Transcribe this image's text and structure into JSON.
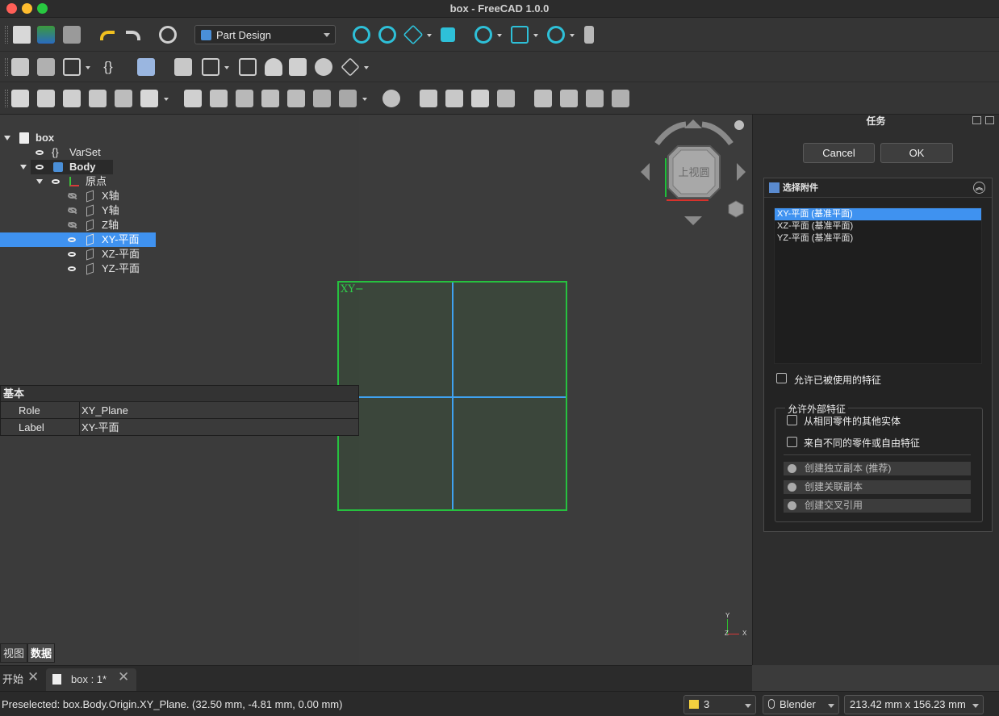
{
  "window": {
    "title": "box - FreeCAD 1.0.0"
  },
  "toolbar": {
    "workbench": "Part Design",
    "colors": {
      "accent": "#3f92f0",
      "plane_border": "#26c13f"
    }
  },
  "tree": {
    "root": "box",
    "varset": "VarSet",
    "varset_icon_glyph": "{}",
    "body": "Body",
    "origin": "原点",
    "x_axis": "X轴",
    "y_axis": "Y轴",
    "z_axis": "Z轴",
    "xy_plane": "XY-平面",
    "xz_plane": "XZ-平面",
    "yz_plane": "YZ-平面"
  },
  "properties": {
    "group": "基本",
    "rows": [
      {
        "name": "Role",
        "value": "XY_Plane"
      },
      {
        "name": "Label",
        "value": "XY-平面"
      }
    ]
  },
  "combo_tabs": {
    "view": "视图",
    "data": "数据"
  },
  "doc_tabs": {
    "start": "开始",
    "doc": "box : 1*"
  },
  "viewport": {
    "plane_label": "XY−",
    "navicube_face": "上视圆",
    "axis_y": "Y",
    "axis_z": "Z",
    "axis_x": "X"
  },
  "task": {
    "title": "任务",
    "cancel": "Cancel",
    "ok": "OK",
    "panel_title": "选择附件",
    "references": [
      "XY-平面 (基准平面)",
      "XZ-平面 (基准平面)",
      "YZ-平面 (基准平面)"
    ],
    "allow_used": "允许已被使用的特征",
    "external_legend": "允许外部特征",
    "same_part": "从相同零件的其他实体",
    "diff_part": "来自不同的零件或自由特征",
    "radio_independent": "创建独立副本 (推荐)",
    "radio_dependent": "创建关联副本",
    "radio_cross": "创建交叉引用"
  },
  "status": {
    "message": "Preselected: box.Body.Origin.XY_Plane. (32.50 mm, -4.81 mm, 0.00 mm)",
    "level": "3",
    "nav_style": "Blender",
    "dimensions": "213.42 mm x 156.23 mm"
  }
}
